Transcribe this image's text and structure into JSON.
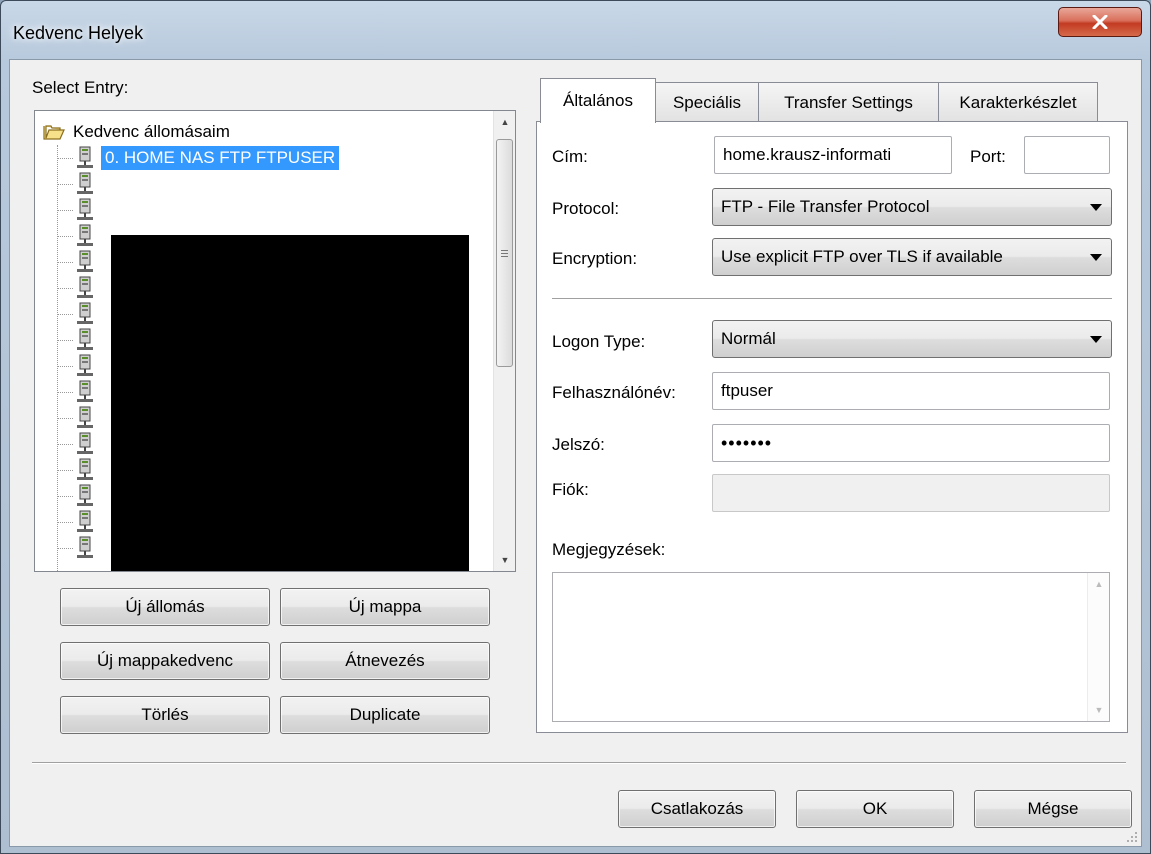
{
  "window": {
    "title": "Kedvenc Helyek",
    "close_symbol": "X"
  },
  "left": {
    "select_entry_label": "Select Entry:",
    "tree": {
      "root_label": "Kedvenc állomásaim",
      "selected_item": "0. HOME NAS FTP FTPUSER",
      "item_count": 14
    },
    "buttons": {
      "new_site": "Új állomás",
      "new_folder": "Új mappa",
      "new_bookmark": "Új mappakedvenc",
      "rename": "Átnevezés",
      "delete": "Törlés",
      "duplicate": "Duplicate"
    }
  },
  "tabs": [
    {
      "label": "Általános",
      "active": true
    },
    {
      "label": "Speciális",
      "active": false
    },
    {
      "label": "Transfer Settings",
      "active": false
    },
    {
      "label": "Karakterkészlet",
      "active": false
    }
  ],
  "general": {
    "host_label": "Cím:",
    "host_value": "home.krausz-informati",
    "port_label": "Port:",
    "port_value": "",
    "protocol_label": "Protocol:",
    "protocol_value": "FTP - File Transfer Protocol",
    "encryption_label": "Encryption:",
    "encryption_value": "Use explicit FTP over TLS if available",
    "logon_type_label": "Logon Type:",
    "logon_type_value": "Normál",
    "user_label": "Felhasználónév:",
    "user_value": "ftpuser",
    "password_label": "Jelszó:",
    "password_value": "•••••••",
    "account_label": "Fiók:",
    "account_value": "",
    "comments_label": "Megjegyzések:"
  },
  "footer": {
    "connect": "Csatlakozás",
    "ok": "OK",
    "cancel": "Mégse"
  },
  "colors": {
    "selection": "#3399ff",
    "close_button": "#c23b22"
  }
}
